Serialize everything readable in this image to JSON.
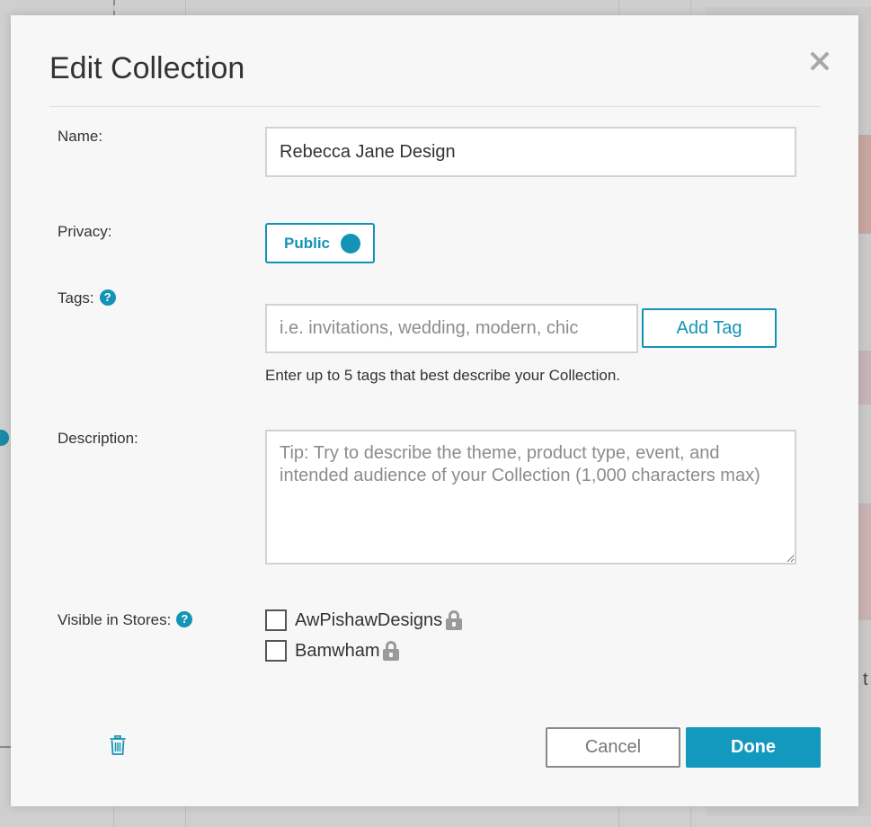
{
  "modal": {
    "title": "Edit Collection",
    "close_icon": "close-icon"
  },
  "form": {
    "name": {
      "label": "Name:",
      "value": "Rebecca Jane Design"
    },
    "privacy": {
      "label": "Privacy:",
      "value": "Public",
      "enabled": true
    },
    "tags": {
      "label": "Tags:",
      "help": "?",
      "placeholder": "i.e. invitations, wedding, modern, chic",
      "add_button": "Add Tag",
      "hint": "Enter up to 5 tags that best describe your Collection."
    },
    "description": {
      "label": "Description:",
      "placeholder": "Tip: Try to describe the theme, product type, event, and intended audience of your Collection (1,000 characters max)"
    },
    "stores": {
      "label": "Visible in Stores:",
      "help": "?",
      "items": [
        {
          "name": "AwPishawDesigns",
          "checked": false,
          "locked": true
        },
        {
          "name": "Bamwham",
          "checked": false,
          "locked": true
        }
      ]
    }
  },
  "footer": {
    "delete_icon": "trash-icon",
    "cancel_label": "Cancel",
    "done_label": "Done"
  },
  "colors": {
    "accent": "#1393b5",
    "done_bg": "#1499be",
    "modal_bg": "#f7f7f7"
  },
  "background": {
    "partial_letter": "t"
  }
}
